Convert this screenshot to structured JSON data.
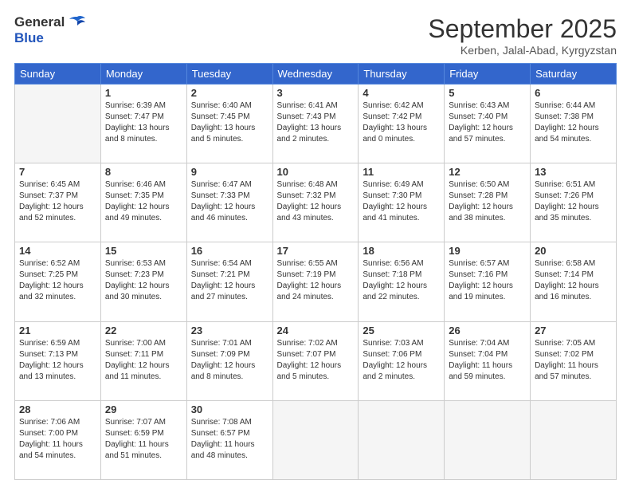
{
  "header": {
    "logo_general": "General",
    "logo_blue": "Blue",
    "month_title": "September 2025",
    "location": "Kerben, Jalal-Abad, Kyrgyzstan"
  },
  "days_of_week": [
    "Sunday",
    "Monday",
    "Tuesday",
    "Wednesday",
    "Thursday",
    "Friday",
    "Saturday"
  ],
  "weeks": [
    [
      {
        "day": "",
        "sunrise": "",
        "sunset": "",
        "daylight": ""
      },
      {
        "day": "1",
        "sunrise": "Sunrise: 6:39 AM",
        "sunset": "Sunset: 7:47 PM",
        "daylight": "Daylight: 13 hours and 8 minutes."
      },
      {
        "day": "2",
        "sunrise": "Sunrise: 6:40 AM",
        "sunset": "Sunset: 7:45 PM",
        "daylight": "Daylight: 13 hours and 5 minutes."
      },
      {
        "day": "3",
        "sunrise": "Sunrise: 6:41 AM",
        "sunset": "Sunset: 7:43 PM",
        "daylight": "Daylight: 13 hours and 2 minutes."
      },
      {
        "day": "4",
        "sunrise": "Sunrise: 6:42 AM",
        "sunset": "Sunset: 7:42 PM",
        "daylight": "Daylight: 13 hours and 0 minutes."
      },
      {
        "day": "5",
        "sunrise": "Sunrise: 6:43 AM",
        "sunset": "Sunset: 7:40 PM",
        "daylight": "Daylight: 12 hours and 57 minutes."
      },
      {
        "day": "6",
        "sunrise": "Sunrise: 6:44 AM",
        "sunset": "Sunset: 7:38 PM",
        "daylight": "Daylight: 12 hours and 54 minutes."
      }
    ],
    [
      {
        "day": "7",
        "sunrise": "Sunrise: 6:45 AM",
        "sunset": "Sunset: 7:37 PM",
        "daylight": "Daylight: 12 hours and 52 minutes."
      },
      {
        "day": "8",
        "sunrise": "Sunrise: 6:46 AM",
        "sunset": "Sunset: 7:35 PM",
        "daylight": "Daylight: 12 hours and 49 minutes."
      },
      {
        "day": "9",
        "sunrise": "Sunrise: 6:47 AM",
        "sunset": "Sunset: 7:33 PM",
        "daylight": "Daylight: 12 hours and 46 minutes."
      },
      {
        "day": "10",
        "sunrise": "Sunrise: 6:48 AM",
        "sunset": "Sunset: 7:32 PM",
        "daylight": "Daylight: 12 hours and 43 minutes."
      },
      {
        "day": "11",
        "sunrise": "Sunrise: 6:49 AM",
        "sunset": "Sunset: 7:30 PM",
        "daylight": "Daylight: 12 hours and 41 minutes."
      },
      {
        "day": "12",
        "sunrise": "Sunrise: 6:50 AM",
        "sunset": "Sunset: 7:28 PM",
        "daylight": "Daylight: 12 hours and 38 minutes."
      },
      {
        "day": "13",
        "sunrise": "Sunrise: 6:51 AM",
        "sunset": "Sunset: 7:26 PM",
        "daylight": "Daylight: 12 hours and 35 minutes."
      }
    ],
    [
      {
        "day": "14",
        "sunrise": "Sunrise: 6:52 AM",
        "sunset": "Sunset: 7:25 PM",
        "daylight": "Daylight: 12 hours and 32 minutes."
      },
      {
        "day": "15",
        "sunrise": "Sunrise: 6:53 AM",
        "sunset": "Sunset: 7:23 PM",
        "daylight": "Daylight: 12 hours and 30 minutes."
      },
      {
        "day": "16",
        "sunrise": "Sunrise: 6:54 AM",
        "sunset": "Sunset: 7:21 PM",
        "daylight": "Daylight: 12 hours and 27 minutes."
      },
      {
        "day": "17",
        "sunrise": "Sunrise: 6:55 AM",
        "sunset": "Sunset: 7:19 PM",
        "daylight": "Daylight: 12 hours and 24 minutes."
      },
      {
        "day": "18",
        "sunrise": "Sunrise: 6:56 AM",
        "sunset": "Sunset: 7:18 PM",
        "daylight": "Daylight: 12 hours and 22 minutes."
      },
      {
        "day": "19",
        "sunrise": "Sunrise: 6:57 AM",
        "sunset": "Sunset: 7:16 PM",
        "daylight": "Daylight: 12 hours and 19 minutes."
      },
      {
        "day": "20",
        "sunrise": "Sunrise: 6:58 AM",
        "sunset": "Sunset: 7:14 PM",
        "daylight": "Daylight: 12 hours and 16 minutes."
      }
    ],
    [
      {
        "day": "21",
        "sunrise": "Sunrise: 6:59 AM",
        "sunset": "Sunset: 7:13 PM",
        "daylight": "Daylight: 12 hours and 13 minutes."
      },
      {
        "day": "22",
        "sunrise": "Sunrise: 7:00 AM",
        "sunset": "Sunset: 7:11 PM",
        "daylight": "Daylight: 12 hours and 11 minutes."
      },
      {
        "day": "23",
        "sunrise": "Sunrise: 7:01 AM",
        "sunset": "Sunset: 7:09 PM",
        "daylight": "Daylight: 12 hours and 8 minutes."
      },
      {
        "day": "24",
        "sunrise": "Sunrise: 7:02 AM",
        "sunset": "Sunset: 7:07 PM",
        "daylight": "Daylight: 12 hours and 5 minutes."
      },
      {
        "day": "25",
        "sunrise": "Sunrise: 7:03 AM",
        "sunset": "Sunset: 7:06 PM",
        "daylight": "Daylight: 12 hours and 2 minutes."
      },
      {
        "day": "26",
        "sunrise": "Sunrise: 7:04 AM",
        "sunset": "Sunset: 7:04 PM",
        "daylight": "Daylight: 11 hours and 59 minutes."
      },
      {
        "day": "27",
        "sunrise": "Sunrise: 7:05 AM",
        "sunset": "Sunset: 7:02 PM",
        "daylight": "Daylight: 11 hours and 57 minutes."
      }
    ],
    [
      {
        "day": "28",
        "sunrise": "Sunrise: 7:06 AM",
        "sunset": "Sunset: 7:00 PM",
        "daylight": "Daylight: 11 hours and 54 minutes."
      },
      {
        "day": "29",
        "sunrise": "Sunrise: 7:07 AM",
        "sunset": "Sunset: 6:59 PM",
        "daylight": "Daylight: 11 hours and 51 minutes."
      },
      {
        "day": "30",
        "sunrise": "Sunrise: 7:08 AM",
        "sunset": "Sunset: 6:57 PM",
        "daylight": "Daylight: 11 hours and 48 minutes."
      },
      {
        "day": "",
        "sunrise": "",
        "sunset": "",
        "daylight": ""
      },
      {
        "day": "",
        "sunrise": "",
        "sunset": "",
        "daylight": ""
      },
      {
        "day": "",
        "sunrise": "",
        "sunset": "",
        "daylight": ""
      },
      {
        "day": "",
        "sunrise": "",
        "sunset": "",
        "daylight": ""
      }
    ]
  ]
}
